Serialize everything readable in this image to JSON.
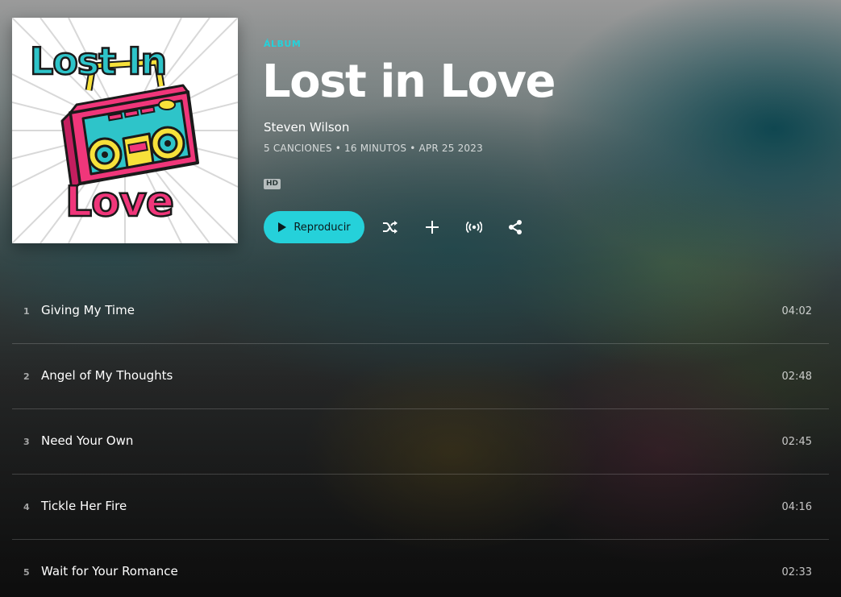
{
  "album": {
    "type_label": "ÁLBUM",
    "title": "Lost in Love",
    "artist": "Steven Wilson",
    "meta": "5 CANCIONES • 16 MINUTOS • APR 25 2023",
    "quality_badge": "HD",
    "cover": {
      "text_top": "Lost In",
      "text_bottom": "Love",
      "accent_teal": "#2ec4c9",
      "accent_pink": "#f0367a",
      "accent_yellow": "#f7e13a"
    }
  },
  "actions": {
    "play_label": "Reproducir",
    "play_color": "#25d1da",
    "icons": [
      "play-icon",
      "shuffle-icon",
      "plus-icon",
      "station-icon",
      "share-icon"
    ]
  },
  "tracks": [
    {
      "number": "1",
      "title": "Giving My Time",
      "duration": "04:02"
    },
    {
      "number": "2",
      "title": "Angel of My Thoughts",
      "duration": "02:48"
    },
    {
      "number": "3",
      "title": "Need Your Own",
      "duration": "02:45"
    },
    {
      "number": "4",
      "title": "Tickle Her Fire",
      "duration": "04:16"
    },
    {
      "number": "5",
      "title": "Wait for Your Romance",
      "duration": "02:33"
    }
  ]
}
